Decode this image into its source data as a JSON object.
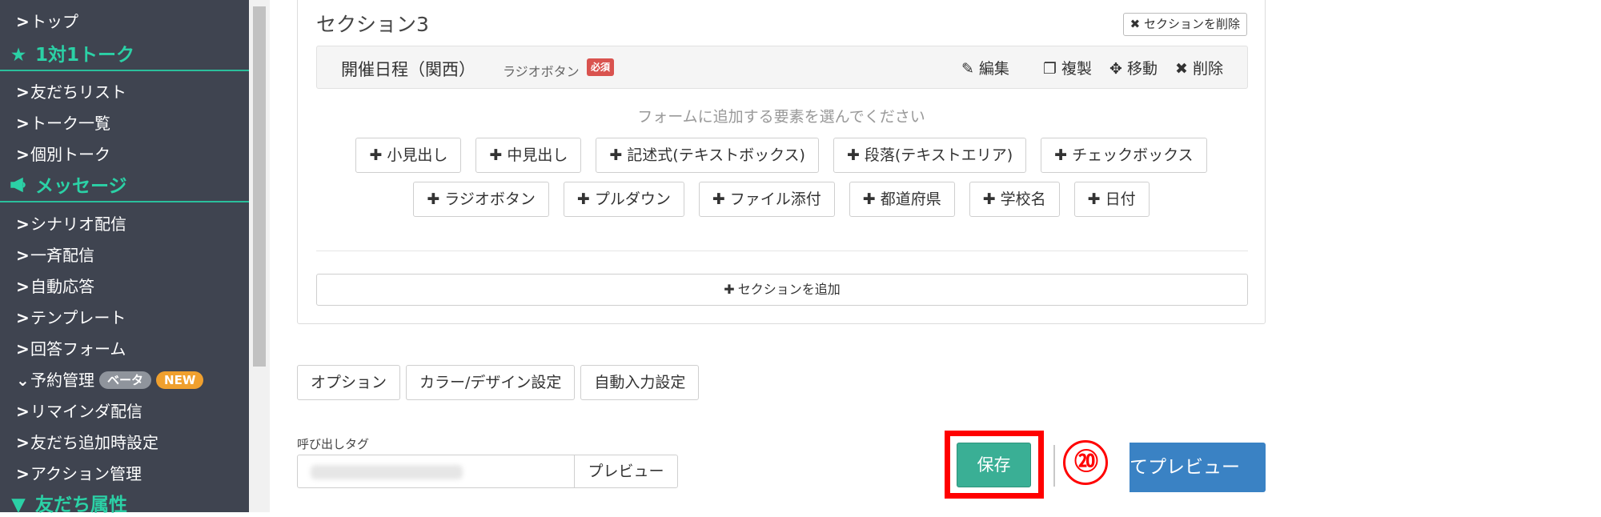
{
  "sidebar": {
    "item_top": "トップ",
    "section_talk": "1対1トーク",
    "friends_list": "友だちリスト",
    "talk_list": "トーク一覧",
    "individual_talk": "個別トーク",
    "section_message": "メッセージ",
    "scenario": "シナリオ配信",
    "broadcast": "一斉配信",
    "auto_reply": "自動応答",
    "template": "テンプレート",
    "answer_form": "回答フォーム",
    "reservation": "予約管理",
    "beta_badge": "ベータ",
    "new_badge": "NEW",
    "reminder": "リマインダ配信",
    "friend_add_settings": "友だち追加時設定",
    "action_mgmt": "アクション管理",
    "section_attributes": "友だち属性"
  },
  "section": {
    "title": "セクション3",
    "delete_label": "セクションを削除",
    "field": {
      "name": "開催日程（関西）",
      "type": "ラジオボタン",
      "required": "必須",
      "actions": [
        "編集",
        "複製",
        "移動",
        "削除"
      ]
    },
    "hint": "フォームに追加する要素を選んでください",
    "add_row1": [
      "小見出し",
      "中見出し",
      "記述式(テキストボックス)",
      "段落(テキストエリア)",
      "チェックボックス"
    ],
    "add_row2": [
      "ラジオボタン",
      "プルダウン",
      "ファイル添付",
      "都道府県",
      "学校名",
      "日付"
    ],
    "add_section": "セクションを追加"
  },
  "tabs": [
    "オプション",
    "カラー/デザイン設定",
    "自動入力設定"
  ],
  "call_tag": {
    "label": "呼び出しタグ",
    "preview": "プレビュー"
  },
  "save_label": "保存",
  "step_number": "⑳",
  "preview_button": "てプレビュー",
  "colors": {
    "sidebar_bg": "#3f4450",
    "accent_green": "#2bd1a6",
    "save_green": "#3aaf95",
    "preview_blue": "#3a82c4",
    "highlight_red": "#ff0000"
  }
}
